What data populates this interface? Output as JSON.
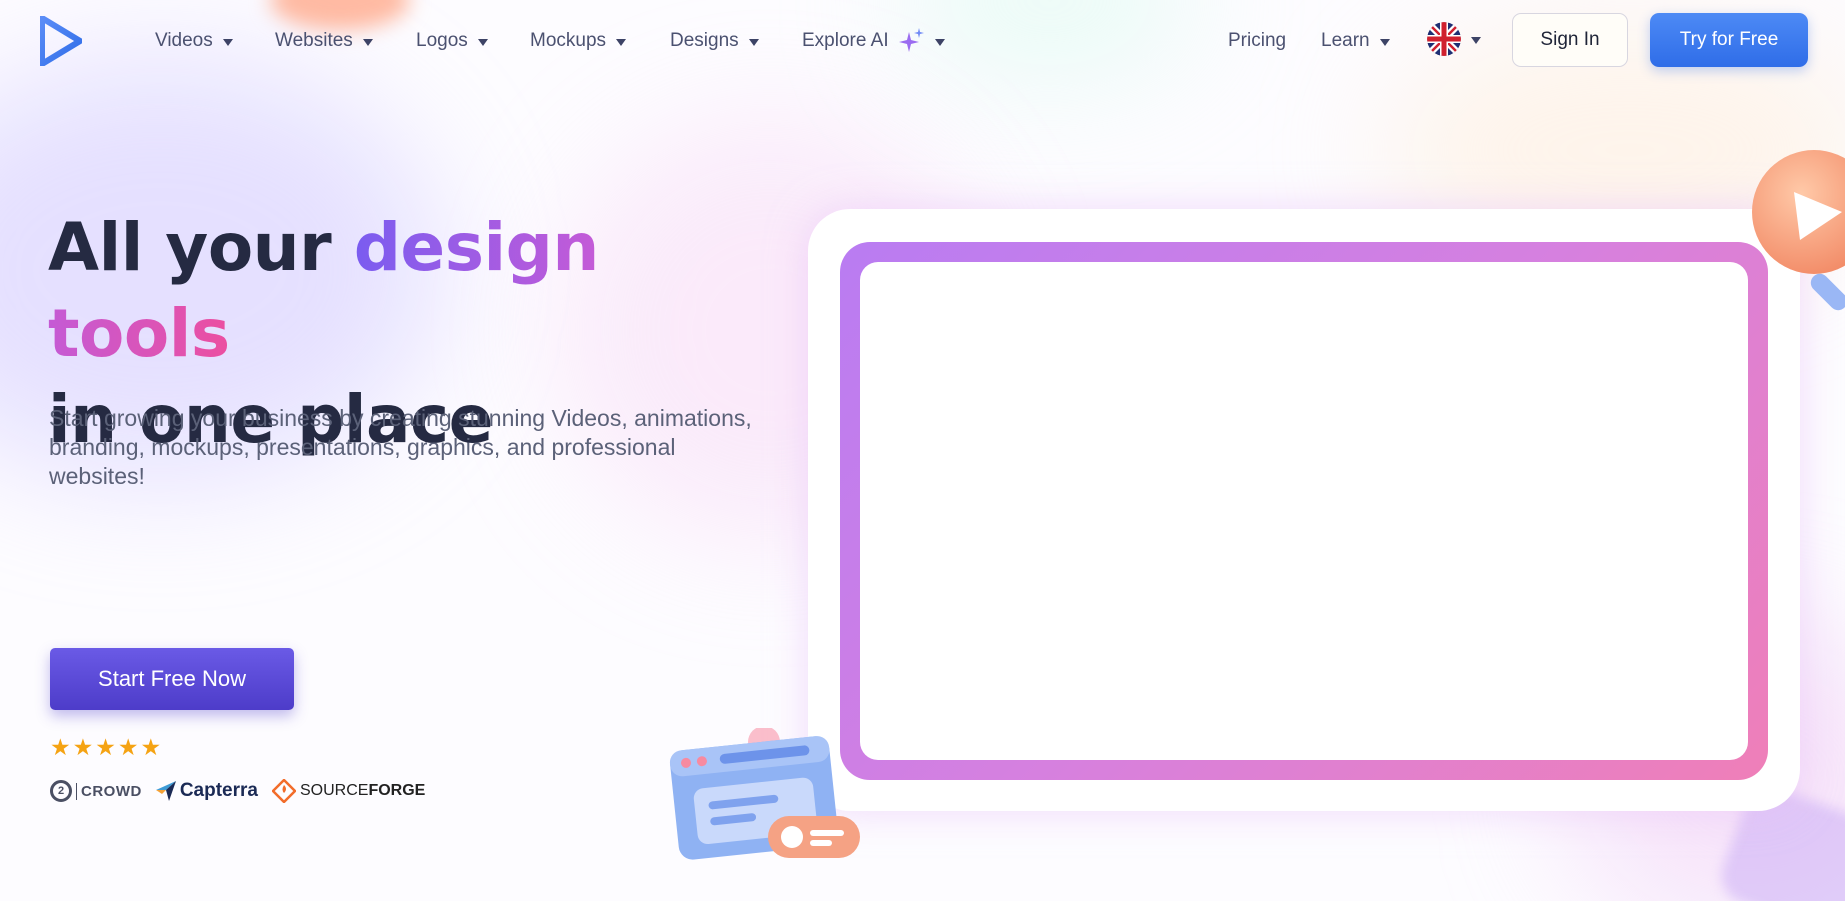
{
  "nav": {
    "items": [
      {
        "label": "Videos",
        "has_dropdown": true
      },
      {
        "label": "Websites",
        "has_dropdown": true
      },
      {
        "label": "Logos",
        "has_dropdown": true
      },
      {
        "label": "Mockups",
        "has_dropdown": true
      },
      {
        "label": "Designs",
        "has_dropdown": true
      },
      {
        "label": "Explore AI",
        "has_dropdown": true,
        "icon": "sparkle-icon"
      }
    ],
    "pricing": "Pricing",
    "learn": "Learn",
    "language_icon": "uk-flag-icon",
    "sign_in": "Sign In",
    "try_free": "Try for Free"
  },
  "hero": {
    "title_plain_1": "All your ",
    "title_highlight": "design tools",
    "title_plain_2": "in one place",
    "subtitle": "Start growing your business by creating stunning Videos, animations, branding, mockups, presentations, graphics, and professional websites!",
    "cta": "Start Free Now",
    "rating_stars": 5
  },
  "reviews": {
    "g2": "CROWD",
    "capterra": "Capterra",
    "sourceforge_a": "SOURCE",
    "sourceforge_b": "FORGE"
  },
  "colors": {
    "primary_blue": "#2f6de8",
    "cta_purple": "#5a49d9",
    "title_dark": "#252a42",
    "highlight_start": "#7a5cf0",
    "highlight_end": "#ec4fa0",
    "star": "#f5a313"
  }
}
